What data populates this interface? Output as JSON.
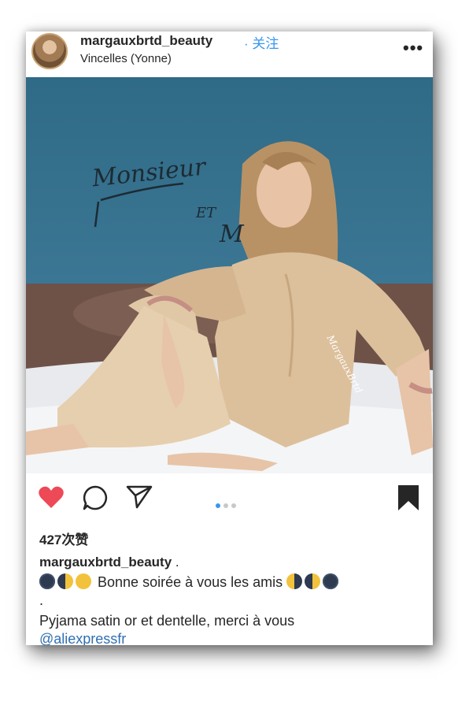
{
  "post": {
    "username": "margauxbrtd_beauty",
    "separator": "·",
    "follow_label": "关注",
    "location": "Vincelles (Yonne)",
    "more_label": "•••"
  },
  "photo": {
    "wall_text_1": "Monsieur",
    "wall_text_2": "ET",
    "wall_text_3": "M",
    "watermark": "MargauxBrtd"
  },
  "actions": {
    "like_icon": "heart-filled-icon",
    "comment_icon": "comment-icon",
    "share_icon": "paper-plane-icon",
    "save_icon": "bookmark-filled-icon",
    "carousel_active_index": 1,
    "carousel_count": 3
  },
  "likes_label": "427次赞",
  "caption": {
    "username": "margauxbrtd_beauty",
    "period": " .",
    "line1_text": "Bonne soirée à vous les amis",
    "line2_text": ".",
    "line3_text": "Pyjama satin or et dentelle, merci à vous",
    "mention": "@aliexpressfr"
  },
  "colors": {
    "like_red": "#ed4956",
    "link_blue": "#3897f0",
    "wall_blue": "#3a7593",
    "text": "#262626"
  }
}
